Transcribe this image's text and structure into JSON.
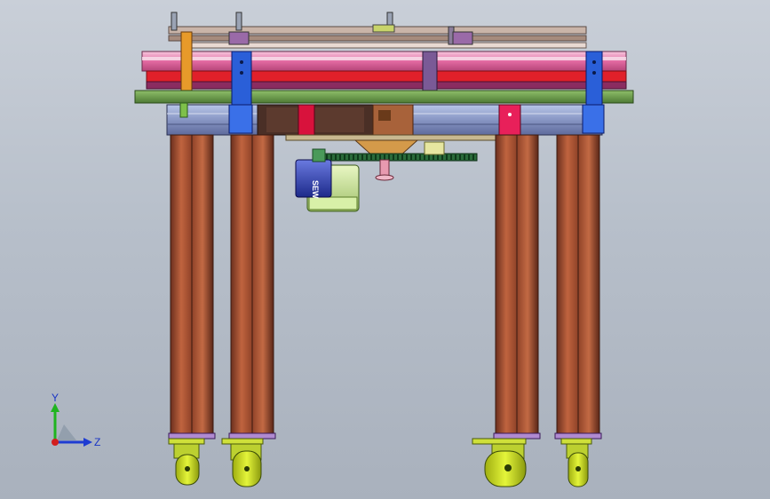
{
  "viewport": {
    "background_top": "#c9cfd8",
    "background_bottom": "#a9b1bd"
  },
  "model": {
    "motor_label": "SEW",
    "colors": {
      "frame_blue_bracket": "#2a5fd8",
      "leg_copper": "#b35a3a",
      "top_plate_green": "#6a9a4a",
      "pink_rail": "#e06aa0",
      "red_rail": "#e0202a",
      "wheel_yellow": "#d8ec1a",
      "motor_blue": "#3040b0",
      "gear_green": "#2a6a3a"
    }
  },
  "triad": {
    "y_label": "Y",
    "z_label": "Z",
    "x_color": "#d21e1e",
    "y_color": "#1fb41f",
    "z_color": "#1e3cd2"
  }
}
